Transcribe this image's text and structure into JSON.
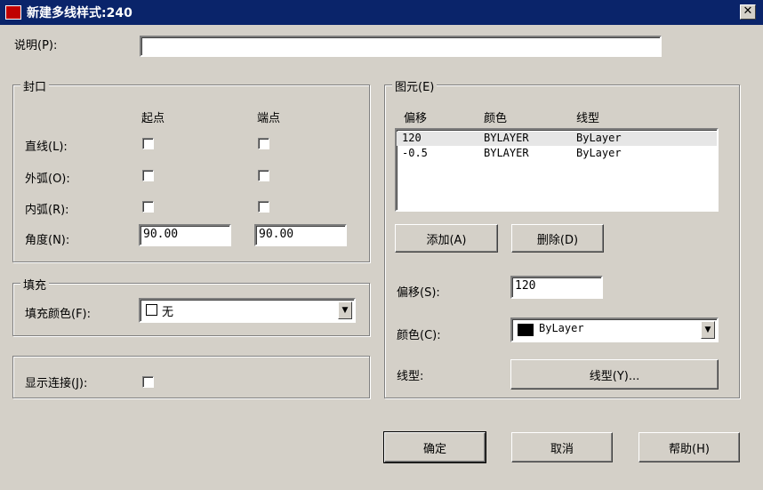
{
  "window": {
    "title": "新建多线样式:240",
    "close_glyph": "✕"
  },
  "description": {
    "label": "说明(P):",
    "value": ""
  },
  "caps": {
    "group_label": "封口",
    "col_start": "起点",
    "col_end": "端点",
    "rows": [
      {
        "label": "直线(L):"
      },
      {
        "label": "外弧(O):"
      },
      {
        "label": "内弧(R):"
      }
    ],
    "angle_label": "角度(N):",
    "angle_start": "90.00",
    "angle_end": "90.00"
  },
  "fill": {
    "group_label": "填充",
    "color_label": "填充颜色(F):",
    "color_value": "无"
  },
  "joints": {
    "label": "显示连接(J):"
  },
  "elements": {
    "group_label": "图元(E)",
    "headers": [
      "偏移",
      "颜色",
      "线型"
    ],
    "rows": [
      {
        "offset": "120",
        "color": "BYLAYER",
        "linetype": "ByLayer"
      },
      {
        "offset": "-0.5",
        "color": "BYLAYER",
        "linetype": "ByLayer"
      }
    ],
    "add_label": "添加(A)",
    "delete_label": "删除(D)",
    "offset_label": "偏移(S):",
    "offset_value": "120",
    "color_label": "颜色(C):",
    "color_value": "ByLayer",
    "linetype_label": "线型:",
    "linetype_button": "线型(Y)..."
  },
  "footer": {
    "ok": "确定",
    "cancel": "取消",
    "help": "帮助(H)"
  },
  "colors": {
    "titlebar": "#0a246a",
    "dialog": "#d4d0c8",
    "swatch": "#000000"
  }
}
